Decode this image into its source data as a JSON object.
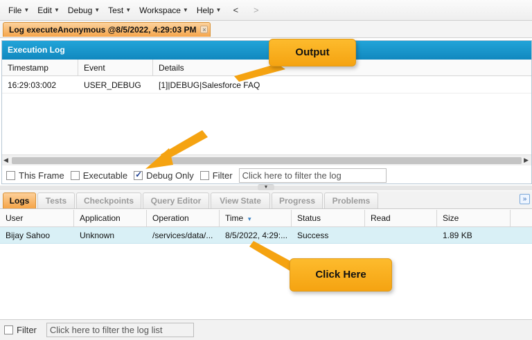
{
  "menu": {
    "items": [
      "File",
      "Edit",
      "Debug",
      "Test",
      "Workspace",
      "Help"
    ],
    "back": "<",
    "forward": ">"
  },
  "log_tab": {
    "label": "Log executeAnonymous @8/5/2022, 4:29:03 PM",
    "close": "×"
  },
  "execution_log": {
    "title": "Execution Log",
    "columns": [
      "Timestamp",
      "Event",
      "Details"
    ],
    "rows": [
      {
        "timestamp": "16:29:03:002",
        "event": "USER_DEBUG",
        "details": "[1]|DEBUG|Salesforce FAQ"
      }
    ],
    "filters": {
      "this_frame": {
        "label": "This Frame",
        "checked": false
      },
      "executable": {
        "label": "Executable",
        "checked": false
      },
      "debug_only": {
        "label": "Debug Only",
        "checked": true
      },
      "filter": {
        "label": "Filter",
        "checked": false
      }
    },
    "filter_placeholder": "Click here to filter the log"
  },
  "bottom_tabs": [
    "Logs",
    "Tests",
    "Checkpoints",
    "Query Editor",
    "View State",
    "Progress",
    "Problems"
  ],
  "active_tab": "Logs",
  "logs": {
    "columns": [
      "User",
      "Application",
      "Operation",
      "Time",
      "Status",
      "Read",
      "Size"
    ],
    "sort_column": "Time",
    "rows": [
      {
        "user": "Bijay Sahoo",
        "application": "Unknown",
        "operation": "/services/data/...",
        "time": "8/5/2022, 4:29:...",
        "status": "Success",
        "read": "",
        "size": "1.89 KB"
      }
    ],
    "filter_label": "Filter",
    "filter_placeholder": "Click here to filter the log list"
  },
  "callouts": {
    "output": "Output",
    "click_here": "Click Here"
  },
  "colors": {
    "accent_orange": "#f5a447",
    "header_blue": "#1a96cc",
    "row_highlight": "#d9f0f6",
    "callout": "#f9ae1c"
  }
}
